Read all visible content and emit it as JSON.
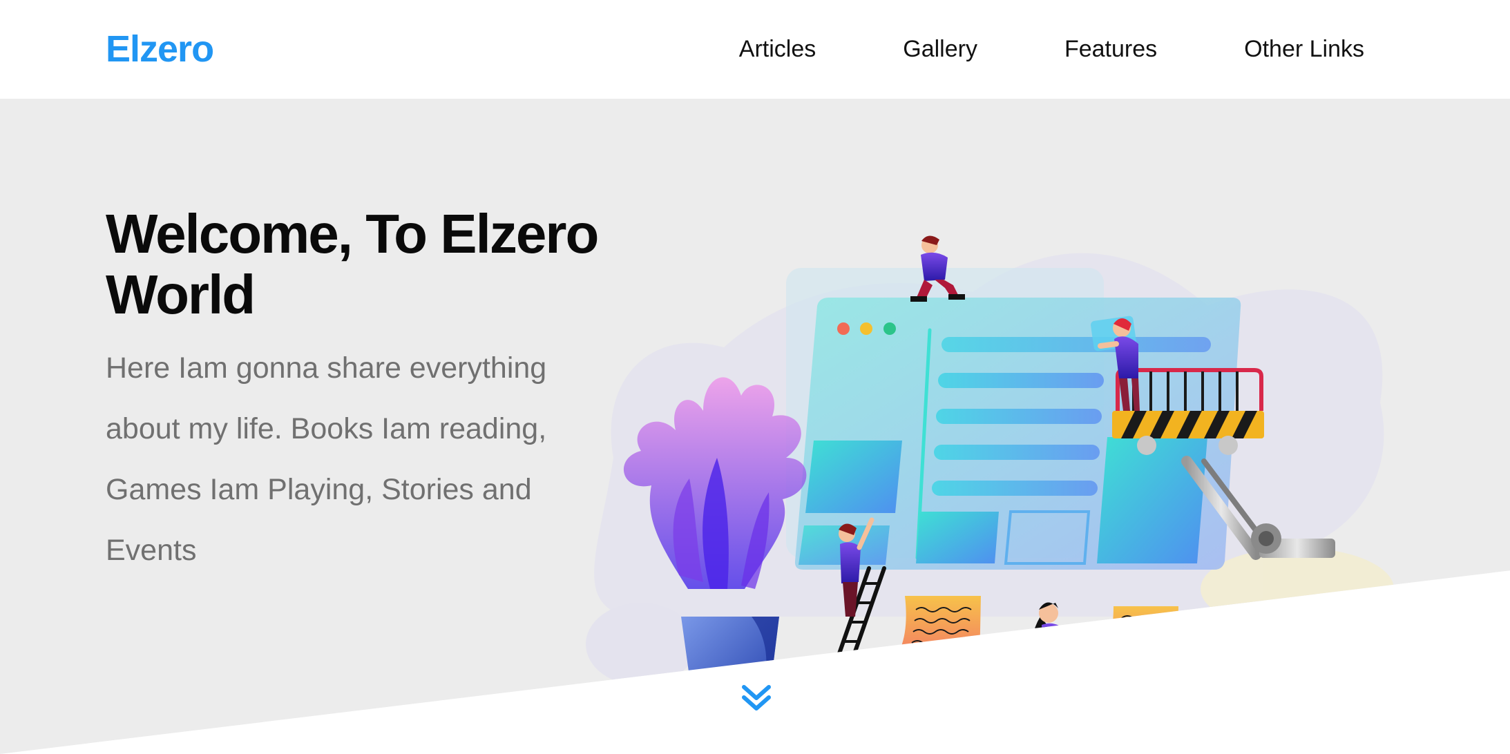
{
  "header": {
    "logo": "Elzero",
    "nav": [
      {
        "label": "Articles"
      },
      {
        "label": "Gallery"
      },
      {
        "label": "Features"
      },
      {
        "label": "Other Links"
      }
    ]
  },
  "landing": {
    "title": "Welcome, To Elzero World",
    "description": "Here Iam gonna share everything about my life. Books Iam reading, Games Iam Playing, Stories and Events"
  },
  "icons": {
    "go_down": "double-chevron-down-icon"
  },
  "colors": {
    "accent": "#2196f3",
    "landing_bg": "#ececec",
    "header_bg": "#ffffff",
    "title": "#0a0a0a",
    "description": "#707070"
  }
}
